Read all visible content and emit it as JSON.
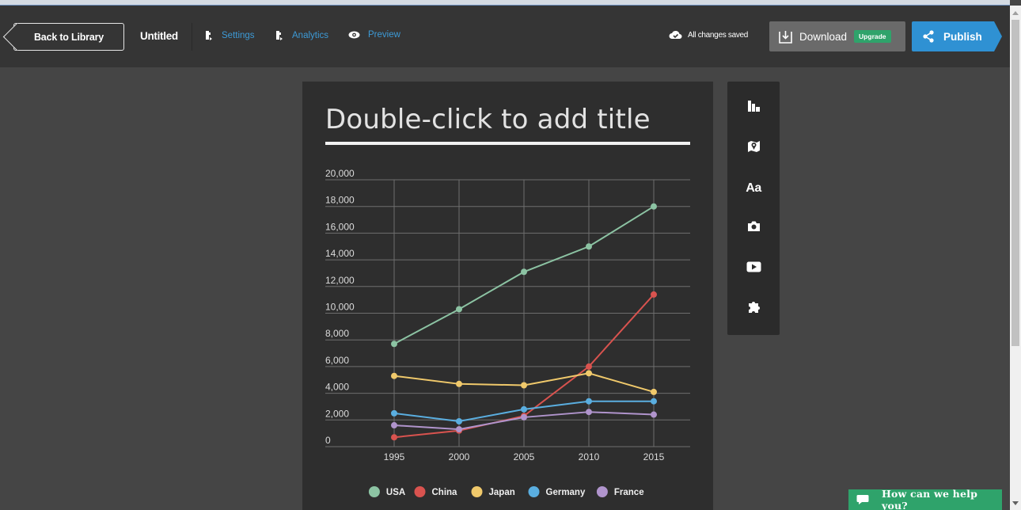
{
  "header": {
    "back_label": "Back to Library",
    "doc_title": "Untitled",
    "nav": [
      {
        "label": "Settings",
        "icon": "settings-icon"
      },
      {
        "label": "Analytics",
        "icon": "analytics-icon"
      },
      {
        "label": "Preview",
        "icon": "eye-icon"
      }
    ],
    "save_status": "All changes saved",
    "download_label": "Download",
    "upgrade_label": "Upgrade",
    "publish_label": "Publish"
  },
  "canvas": {
    "title_placeholder": "Double-click to add title"
  },
  "toolbar": {
    "tools": [
      {
        "name": "chart-tool",
        "icon": "bar-chart-icon"
      },
      {
        "name": "map-tool",
        "icon": "map-icon"
      },
      {
        "name": "text-tool",
        "icon": "text-icon",
        "label": "Aa"
      },
      {
        "name": "photo-tool",
        "icon": "camera-icon"
      },
      {
        "name": "video-tool",
        "icon": "play-icon"
      },
      {
        "name": "integration-tool",
        "icon": "puzzle-icon"
      }
    ]
  },
  "help": {
    "label": "How can we help you?"
  },
  "colors": {
    "accent": "#2f91d3",
    "green": "#2fa36b",
    "link": "#3d9ad6"
  },
  "chart_data": {
    "type": "line",
    "x": [
      "1995",
      "2000",
      "2005",
      "2010",
      "2015"
    ],
    "yticks": [
      "0",
      "2,000",
      "4,000",
      "6,000",
      "8,000",
      "10,000",
      "12,000",
      "14,000",
      "16,000",
      "18,000",
      "20,000"
    ],
    "ylim": [
      0,
      20000
    ],
    "grid": true,
    "legend": "bottom",
    "series": [
      {
        "name": "USA",
        "color": "#8cc3a3",
        "values": [
          7700,
          10300,
          13100,
          15000,
          18000
        ]
      },
      {
        "name": "China",
        "color": "#d9534f",
        "values": [
          700,
          1200,
          2300,
          6000,
          11400
        ]
      },
      {
        "name": "Japan",
        "color": "#f0c96b",
        "values": [
          5300,
          4700,
          4600,
          5500,
          4100
        ]
      },
      {
        "name": "Germany",
        "color": "#5aaee0",
        "values": [
          2500,
          1900,
          2800,
          3400,
          3400
        ]
      },
      {
        "name": "France",
        "color": "#b094cc",
        "values": [
          1600,
          1300,
          2200,
          2600,
          2400
        ]
      }
    ]
  }
}
